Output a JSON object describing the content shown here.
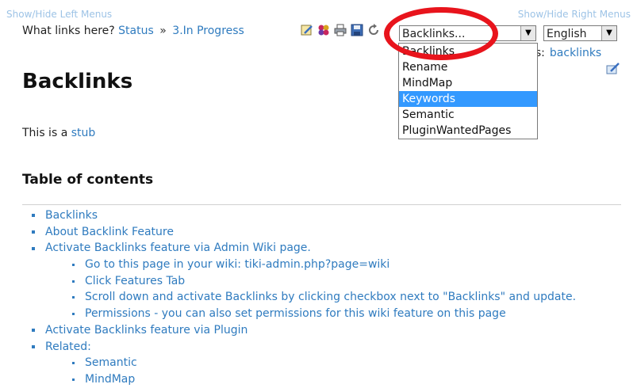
{
  "top_links": {
    "left": "Show/Hide Left Menus",
    "right": "Show/Hide Right Menus"
  },
  "breadcrumb": {
    "prefix": "What links here?",
    "link1": "Status",
    "sep": "»",
    "link2": "3.In Progress"
  },
  "toolbar_icons": [
    "edit-icon",
    "translate-icon",
    "print-icon",
    "save-icon",
    "refresh-icon"
  ],
  "wiki_select": {
    "value": "Backlinks...",
    "options": [
      {
        "label": "Backlinks"
      },
      {
        "label": "Rename"
      },
      {
        "label": "MindMap"
      },
      {
        "label": "Keywords",
        "selected": true
      },
      {
        "label": "Semantic"
      },
      {
        "label": "PluginWantedPages"
      }
    ]
  },
  "language_select": {
    "value": "English"
  },
  "tags": {
    "label": "gs:",
    "value": "backlinks"
  },
  "page": {
    "title": "Backlinks",
    "stub_prefix": "This is a",
    "stub_link": "stub"
  },
  "toc": {
    "heading": "Table of contents",
    "items": [
      {
        "label": "Backlinks",
        "level": 1
      },
      {
        "label": "About Backlink Feature",
        "level": 1
      },
      {
        "label": "Activate Backlinks feature via Admin Wiki page.",
        "level": 1
      },
      {
        "label": "Go to this page in your wiki: tiki-admin.php?page=wiki",
        "level": 2
      },
      {
        "label": "Click Features Tab",
        "level": 2
      },
      {
        "label": "Scroll down and activate Backlinks by clicking checkbox next to \"Backlinks\" and update.",
        "level": 2
      },
      {
        "label": "Permissions - you can also set permissions for this wiki feature on this page",
        "level": 2
      },
      {
        "label": "Activate Backlinks feature via Plugin",
        "level": 1
      },
      {
        "label": "Related:",
        "level": 1
      },
      {
        "label": "Semantic",
        "level": 2
      },
      {
        "label": "MindMap",
        "level": 2
      }
    ]
  },
  "colors": {
    "link": "#2f7bbf",
    "highlight": "#3399ff",
    "annotation": "#e8141c"
  }
}
